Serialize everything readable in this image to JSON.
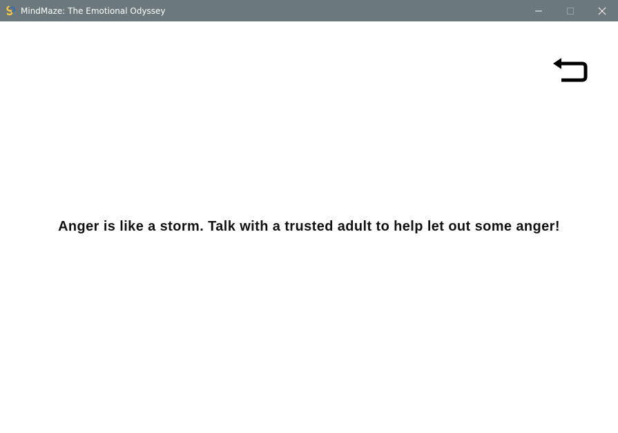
{
  "window": {
    "title": "MindMaze: The Emotional Odyssey",
    "icon": "pygame-snake-icon",
    "titlebar_color": "#6b787d",
    "controls": [
      "minimize-icon",
      "maximize-icon",
      "close-icon"
    ]
  },
  "screen": {
    "back_icon": "return-arrow-icon",
    "message": "Anger is like a storm. Talk with a trusted adult to help let out some anger!",
    "background_color": "#ffffff",
    "text_color": "#111111"
  }
}
